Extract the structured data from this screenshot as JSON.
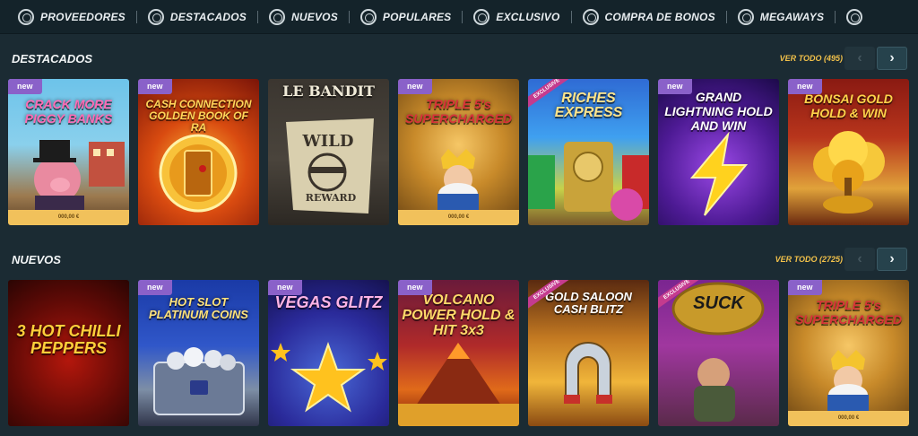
{
  "nav": {
    "items": [
      {
        "label": "PROVEEDORES",
        "icon": "provider-icon"
      },
      {
        "label": "DESTACADOS",
        "icon": "featured-icon"
      },
      {
        "label": "NUEVOS",
        "icon": "new-icon"
      },
      {
        "label": "POPULARES",
        "icon": "popular-icon"
      },
      {
        "label": "EXCLUSIVO",
        "icon": "exclusive-icon"
      },
      {
        "label": "COMPRA DE BONOS",
        "icon": "bonus-buy-icon"
      },
      {
        "label": "MEGAWAYS",
        "icon": "megaways-icon"
      }
    ]
  },
  "sections": [
    {
      "title": "DESTACADOS",
      "ver_todo": "VER TODO (495)",
      "prev": "‹",
      "next": "›",
      "games": [
        {
          "title": "CRACK MORE PIGGY BANKS",
          "badge": "new",
          "jackpot": "000,00 €"
        },
        {
          "title": "CASH CONNECTION GOLDEN BOOK OF RA",
          "badge": "new",
          "jackpot": ""
        },
        {
          "title": "LE BANDIT",
          "badge": "",
          "jackpot": ""
        },
        {
          "title": "TRIPLE 5's SUPERCHARGED",
          "badge": "new",
          "jackpot": "000,00 €"
        },
        {
          "title": "RICHES EXPRESS",
          "badge": "EXCLUSIVE",
          "jackpot": ""
        },
        {
          "title": "GRAND LIGHTNING HOLD AND WIN",
          "badge": "new",
          "jackpot": ""
        },
        {
          "title": "BONSAI GOLD HOLD & WIN",
          "badge": "new",
          "jackpot": ""
        }
      ]
    },
    {
      "title": "NUEVOS",
      "ver_todo": "VER TODO (2725)",
      "prev": "‹",
      "next": "›",
      "games": [
        {
          "title": "3 HOT CHILLI PEPPERS",
          "badge": "",
          "jackpot": ""
        },
        {
          "title": "HOT SLOT PLATINUM COINS",
          "badge": "new",
          "jackpot": ""
        },
        {
          "title": "VEGAS GLITZ",
          "badge": "new",
          "jackpot": ""
        },
        {
          "title": "VOLCANO POWER HOLD & HIT 3x3",
          "badge": "new",
          "jackpot": ""
        },
        {
          "title": "GOLD SALOON CASH BLITZ",
          "badge": "EXCLUSIVE",
          "jackpot": ""
        },
        {
          "title": "SUCK",
          "badge": "EXCLUSIVE",
          "jackpot": ""
        },
        {
          "title": "TRIPLE 5's SUPERCHARGED",
          "badge": "new",
          "jackpot": "000,00 €"
        }
      ]
    }
  ],
  "colors": {
    "accent_gold": "#f2c14a",
    "badge_new": "#8a61c9",
    "badge_exclusive": "#c43b8e",
    "jackpot_bar": "#f1c15b"
  }
}
